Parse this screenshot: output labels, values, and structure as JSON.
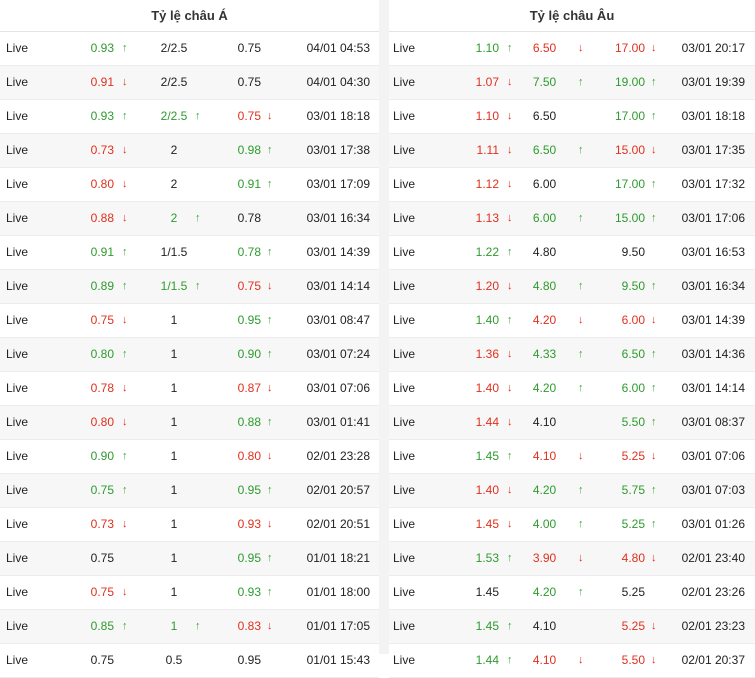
{
  "asian": {
    "title": "Tỷ lệ châu Á",
    "rows": [
      {
        "status": "Live",
        "v1": "0.93",
        "d1": "up",
        "v2": "2/2.5",
        "d2": "",
        "v3": "0.75",
        "d3": "",
        "time": "04/01 04:53"
      },
      {
        "status": "Live",
        "v1": "0.91",
        "d1": "down",
        "v2": "2/2.5",
        "d2": "",
        "v3": "0.75",
        "d3": "",
        "time": "04/01 04:30"
      },
      {
        "status": "Live",
        "v1": "0.93",
        "d1": "up",
        "v2": "2/2.5",
        "d2": "up",
        "v3": "0.75",
        "d3": "down",
        "time": "03/01 18:18"
      },
      {
        "status": "Live",
        "v1": "0.73",
        "d1": "down",
        "v2": "2",
        "d2": "",
        "v3": "0.98",
        "d3": "up",
        "time": "03/01 17:38"
      },
      {
        "status": "Live",
        "v1": "0.80",
        "d1": "down",
        "v2": "2",
        "d2": "",
        "v3": "0.91",
        "d3": "up",
        "time": "03/01 17:09"
      },
      {
        "status": "Live",
        "v1": "0.88",
        "d1": "down",
        "v2": "2",
        "d2": "up",
        "v3": "0.78",
        "d3": "",
        "time": "03/01 16:34"
      },
      {
        "status": "Live",
        "v1": "0.91",
        "d1": "up",
        "v2": "1/1.5",
        "d2": "",
        "v3": "0.78",
        "d3": "up",
        "time": "03/01 14:39"
      },
      {
        "status": "Live",
        "v1": "0.89",
        "d1": "up",
        "v2": "1/1.5",
        "d2": "up",
        "v3": "0.75",
        "d3": "down",
        "time": "03/01 14:14"
      },
      {
        "status": "Live",
        "v1": "0.75",
        "d1": "down",
        "v2": "1",
        "d2": "",
        "v3": "0.95",
        "d3": "up",
        "time": "03/01 08:47"
      },
      {
        "status": "Live",
        "v1": "0.80",
        "d1": "up",
        "v2": "1",
        "d2": "",
        "v3": "0.90",
        "d3": "up",
        "time": "03/01 07:24"
      },
      {
        "status": "Live",
        "v1": "0.78",
        "d1": "down",
        "v2": "1",
        "d2": "",
        "v3": "0.87",
        "d3": "down",
        "time": "03/01 07:06"
      },
      {
        "status": "Live",
        "v1": "0.80",
        "d1": "down",
        "v2": "1",
        "d2": "",
        "v3": "0.88",
        "d3": "up",
        "time": "03/01 01:41"
      },
      {
        "status": "Live",
        "v1": "0.90",
        "d1": "up",
        "v2": "1",
        "d2": "",
        "v3": "0.80",
        "d3": "down",
        "time": "02/01 23:28"
      },
      {
        "status": "Live",
        "v1": "0.75",
        "d1": "up",
        "v2": "1",
        "d2": "",
        "v3": "0.95",
        "d3": "up",
        "time": "02/01 20:57"
      },
      {
        "status": "Live",
        "v1": "0.73",
        "d1": "down",
        "v2": "1",
        "d2": "",
        "v3": "0.93",
        "d3": "down",
        "time": "02/01 20:51"
      },
      {
        "status": "Live",
        "v1": "0.75",
        "d1": "",
        "v2": "1",
        "d2": "",
        "v3": "0.95",
        "d3": "up",
        "time": "01/01 18:21"
      },
      {
        "status": "Live",
        "v1": "0.75",
        "d1": "down",
        "v2": "1",
        "d2": "",
        "v3": "0.93",
        "d3": "up",
        "time": "01/01 18:00"
      },
      {
        "status": "Live",
        "v1": "0.85",
        "d1": "up",
        "v2": "1",
        "d2": "up",
        "v3": "0.83",
        "d3": "down",
        "time": "01/01 17:05"
      },
      {
        "status": "Live",
        "v1": "0.75",
        "d1": "",
        "v2": "0.5",
        "d2": "",
        "v3": "0.95",
        "d3": "",
        "time": "01/01 15:43"
      }
    ]
  },
  "european": {
    "title": "Tỷ lệ châu Âu",
    "rows": [
      {
        "status": "Live",
        "v1": "1.10",
        "d1": "up",
        "v2": "6.50",
        "d2": "down",
        "v3": "17.00",
        "d3": "down",
        "time": "03/01 20:17"
      },
      {
        "status": "Live",
        "v1": "1.07",
        "d1": "down",
        "v2": "7.50",
        "d2": "up",
        "v3": "19.00",
        "d3": "up",
        "time": "03/01 19:39"
      },
      {
        "status": "Live",
        "v1": "1.10",
        "d1": "down",
        "v2": "6.50",
        "d2": "",
        "v3": "17.00",
        "d3": "up",
        "time": "03/01 18:18"
      },
      {
        "status": "Live",
        "v1": "1.11",
        "d1": "down",
        "v2": "6.50",
        "d2": "up",
        "v3": "15.00",
        "d3": "down",
        "time": "03/01 17:35"
      },
      {
        "status": "Live",
        "v1": "1.12",
        "d1": "down",
        "v2": "6.00",
        "d2": "",
        "v3": "17.00",
        "d3": "up",
        "time": "03/01 17:32"
      },
      {
        "status": "Live",
        "v1": "1.13",
        "d1": "down",
        "v2": "6.00",
        "d2": "up",
        "v3": "15.00",
        "d3": "up",
        "time": "03/01 17:06"
      },
      {
        "status": "Live",
        "v1": "1.22",
        "d1": "up",
        "v2": "4.80",
        "d2": "",
        "v3": "9.50",
        "d3": "",
        "time": "03/01 16:53"
      },
      {
        "status": "Live",
        "v1": "1.20",
        "d1": "down",
        "v2": "4.80",
        "d2": "up",
        "v3": "9.50",
        "d3": "up",
        "time": "03/01 16:34"
      },
      {
        "status": "Live",
        "v1": "1.40",
        "d1": "up",
        "v2": "4.20",
        "d2": "down",
        "v3": "6.00",
        "d3": "down",
        "time": "03/01 14:39"
      },
      {
        "status": "Live",
        "v1": "1.36",
        "d1": "down",
        "v2": "4.33",
        "d2": "up",
        "v3": "6.50",
        "d3": "up",
        "time": "03/01 14:36"
      },
      {
        "status": "Live",
        "v1": "1.40",
        "d1": "down",
        "v2": "4.20",
        "d2": "up",
        "v3": "6.00",
        "d3": "up",
        "time": "03/01 14:14"
      },
      {
        "status": "Live",
        "v1": "1.44",
        "d1": "down",
        "v2": "4.10",
        "d2": "",
        "v3": "5.50",
        "d3": "up",
        "time": "03/01 08:37"
      },
      {
        "status": "Live",
        "v1": "1.45",
        "d1": "up",
        "v2": "4.10",
        "d2": "down",
        "v3": "5.25",
        "d3": "down",
        "time": "03/01 07:06"
      },
      {
        "status": "Live",
        "v1": "1.40",
        "d1": "down",
        "v2": "4.20",
        "d2": "up",
        "v3": "5.75",
        "d3": "up",
        "time": "03/01 07:03"
      },
      {
        "status": "Live",
        "v1": "1.45",
        "d1": "down",
        "v2": "4.00",
        "d2": "up",
        "v3": "5.25",
        "d3": "up",
        "time": "03/01 01:26"
      },
      {
        "status": "Live",
        "v1": "1.53",
        "d1": "up",
        "v2": "3.90",
        "d2": "down",
        "v3": "4.80",
        "d3": "down",
        "time": "02/01 23:40"
      },
      {
        "status": "Live",
        "v1": "1.45",
        "d1": "",
        "v2": "4.20",
        "d2": "up",
        "v3": "5.25",
        "d3": "",
        "time": "02/01 23:26"
      },
      {
        "status": "Live",
        "v1": "1.45",
        "d1": "up",
        "v2": "4.10",
        "d2": "",
        "v3": "5.25",
        "d3": "down",
        "time": "02/01 23:23"
      },
      {
        "status": "Live",
        "v1": "1.44",
        "d1": "up",
        "v2": "4.10",
        "d2": "down",
        "v3": "5.50",
        "d3": "down",
        "time": "02/01 20:37"
      }
    ]
  },
  "icons": {
    "up": "↑",
    "down": "↓"
  },
  "colors": {
    "up": "#2e9b2e",
    "down": "#e0301e",
    "neutral": "#222222"
  }
}
